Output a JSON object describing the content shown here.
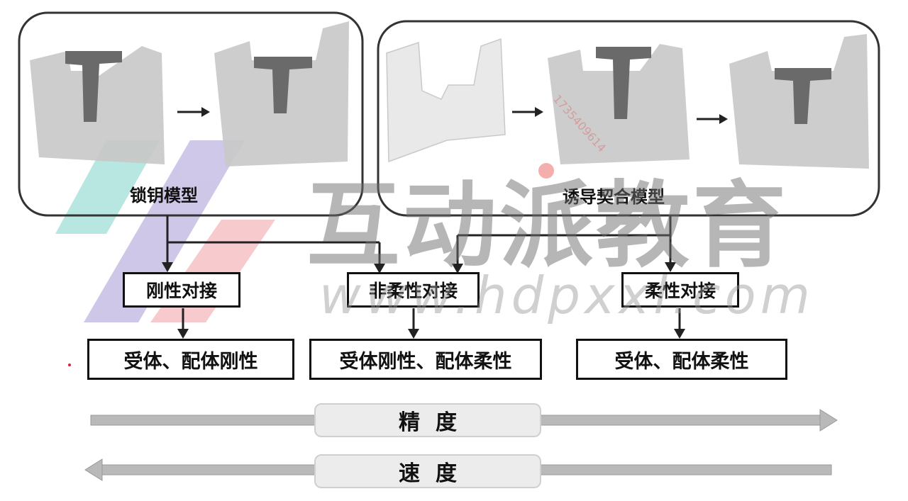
{
  "models": {
    "lock_key": "锁钥模型",
    "induced_fit": "诱导契合模型"
  },
  "docking": {
    "rigid": "刚性对接",
    "semi_flexible": "非柔性对接",
    "flexible": "柔性对接"
  },
  "descriptions": {
    "rigid": "受体、配体刚性",
    "semi_flexible": "受体刚性、配体柔性",
    "flexible": "受体、配体柔性"
  },
  "scales": {
    "precision": "精度",
    "speed": "速度"
  },
  "watermark": {
    "brand": "互动派教育",
    "url": "www.hdpxxl.com",
    "small_text": "1735409614"
  },
  "colors": {
    "receptor_gray": "#c8c8c8",
    "receptor_light": "#e9e9e9",
    "ligand": "#6a6a6a",
    "arrow_gray": "#b9b9b9",
    "teal": "#7fd3c8",
    "purple": "#a99ad6",
    "pink": "#f2a0a6"
  }
}
